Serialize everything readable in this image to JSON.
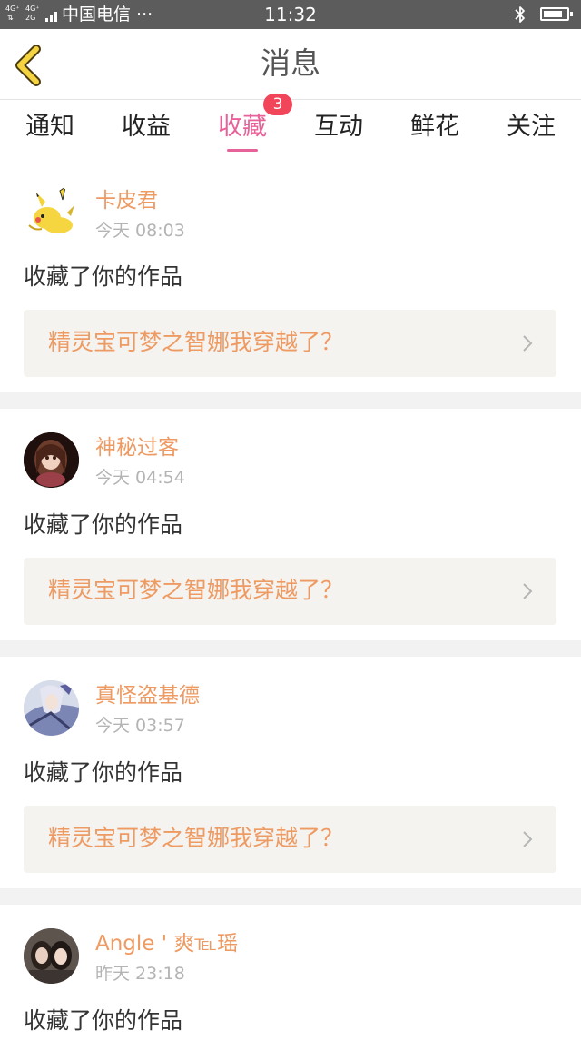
{
  "status_bar": {
    "net_top_left": "4G⁺",
    "net_top_right": "4G⁺",
    "net_bottom_left": "⇅",
    "net_bottom_right": "2G",
    "carrier": "中国电信 ···",
    "time": "11:32",
    "bluetooth_icon": "bluetooth-icon",
    "battery_level": 0.85
  },
  "header": {
    "title": "消息",
    "back_icon": "chevron-left-icon"
  },
  "tabs": [
    {
      "label": "通知"
    },
    {
      "label": "收益"
    },
    {
      "label": "收藏",
      "active": true,
      "badge": "3"
    },
    {
      "label": "互动"
    },
    {
      "label": "鲜花"
    },
    {
      "label": "关注"
    }
  ],
  "colors": {
    "accent_pink": "#e8629a",
    "badge_red": "#f1455a",
    "name_orange": "#ee9a63",
    "card_bg": "#f4f3ef"
  },
  "messages": [
    {
      "user": "卡皮君",
      "time": "今天 08:03",
      "action": "收藏了你的作品",
      "work_title": "精灵宝可梦之智娜我穿越了？",
      "avatar_icon": "pikachu-avatar"
    },
    {
      "user": "神秘过客",
      "time": "今天 04:54",
      "action": "收藏了你的作品",
      "work_title": "精灵宝可梦之智娜我穿越了？",
      "avatar_icon": "doll-avatar"
    },
    {
      "user": "真怪盗基德",
      "time": "今天 03:57",
      "action": "收藏了你的作品",
      "work_title": "精灵宝可梦之智娜我穿越了？",
      "avatar_icon": "anime-avatar"
    },
    {
      "user": "Angle ' 爽℡瑶",
      "time": "昨天 23:18",
      "action": "收藏了你的作品",
      "avatar_icon": "photo-avatar"
    }
  ]
}
